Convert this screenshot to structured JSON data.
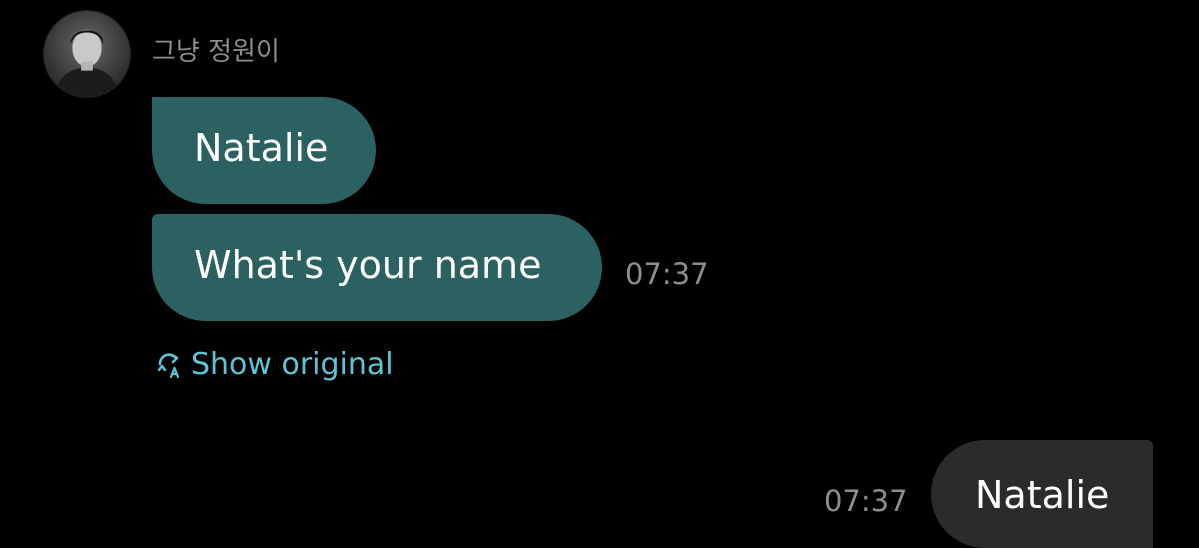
{
  "conversation": {
    "sender": {
      "name": "그냥 정원이",
      "avatar_icon": "user-avatar"
    },
    "incoming": {
      "messages": [
        {
          "text": "Natalie"
        },
        {
          "text": "What's your name"
        }
      ],
      "timestamp": "07:37",
      "show_original_label": "Show original",
      "translate_icon": "translate-refresh-icon"
    },
    "outgoing": {
      "messages": [
        {
          "text": "Natalie"
        }
      ],
      "timestamp": "07:37"
    }
  },
  "colors": {
    "background": "#000000",
    "incoming_bubble": "#2c6161",
    "outgoing_bubble": "#2b2b2b",
    "link_accent": "#5fc3d6",
    "meta_text": "#8e8e8e"
  }
}
